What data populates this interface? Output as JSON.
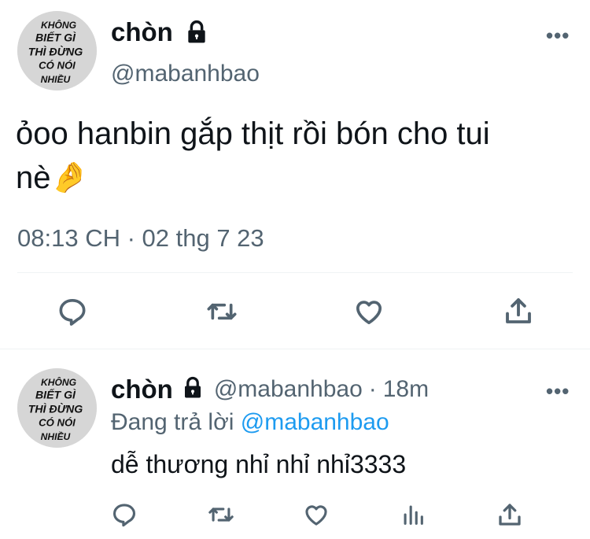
{
  "main_tweet": {
    "avatar_text": [
      "KHÔNG",
      "BIẾT GÌ",
      "THÌ ĐỪNG",
      "CÓ NÓI",
      "NHIỀU"
    ],
    "display_name": "chòn",
    "handle": "@mabanhbao",
    "text_line1": "ỏoo hanbin gắp thịt rồi bón cho tui",
    "text_line2": "nè",
    "emoji": "🤌",
    "timestamp": "08:13 CH · 02 thg 7 23"
  },
  "reply_tweet": {
    "avatar_text": [
      "KHÔNG",
      "BIẾT GÌ",
      "THÌ ĐỪNG",
      "CÓ NÓI",
      "NHIỀU"
    ],
    "display_name": "chòn",
    "handle": "@mabanhbao",
    "separator": "·",
    "time_ago": "18m",
    "replying_prefix": "Đang trả lời",
    "replying_to": "@mabanhbao",
    "text": "dễ thương nhỉ nhỉ nhỉ3333"
  },
  "icons": {
    "lock": "lock-icon",
    "more": "more-icon",
    "reply": "reply-icon",
    "retweet": "retweet-icon",
    "like": "like-icon",
    "share": "share-icon",
    "analytics": "analytics-icon"
  },
  "colors": {
    "text": "#0f1419",
    "secondary": "#536471",
    "mention": "#1d9bf0",
    "divider": "#eff3f4"
  }
}
